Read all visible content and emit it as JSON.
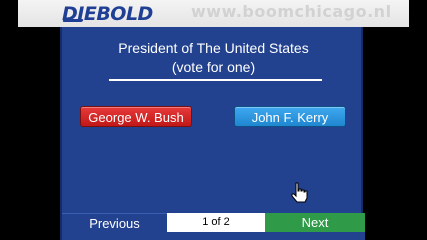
{
  "header": {
    "brand": "DIEBOLD",
    "url": "www.boomchicago.nl"
  },
  "ballot": {
    "title_line1": "President of The United States",
    "title_line2": "(vote for one)",
    "candidates": [
      {
        "name": "George W. Bush",
        "color": "#d42a2a"
      },
      {
        "name": "John F. Kerry",
        "color": "#2d9be6"
      }
    ]
  },
  "nav": {
    "previous_label": "Previous",
    "page_indicator": "1 of 2",
    "next_label": "Next"
  },
  "cursor": {
    "icon": "hand-pointer-icon"
  }
}
